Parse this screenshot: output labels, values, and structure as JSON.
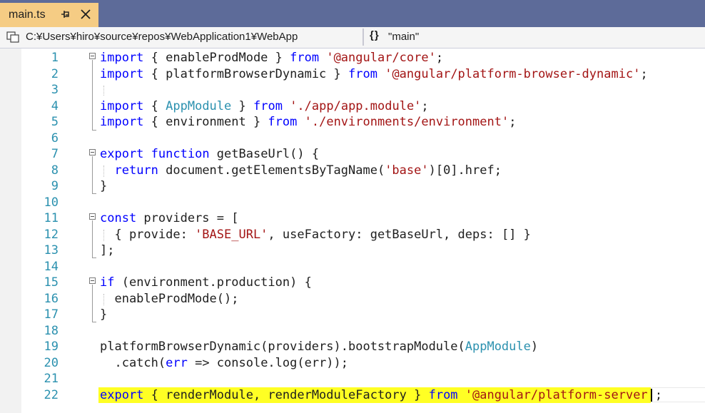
{
  "tab": {
    "title": "main.ts",
    "pin_icon": "pin-icon",
    "close_icon": "close-icon"
  },
  "navbar": {
    "project_icon": "project-icon",
    "project_path": "C:¥Users¥hiro¥source¥repos¥WebApplication1¥WebApp",
    "member_icon": "braces-icon",
    "member": "\"main\""
  },
  "colors": {
    "tabstrip": "#5d6b99",
    "active_tab": "#f5cc84",
    "keyword": "#0000ff",
    "string": "#a31515",
    "type": "#2b91af",
    "line_number": "#2b91af",
    "highlight": "#ffff24"
  },
  "code_lines": [
    {
      "n": "1",
      "tokens": [
        [
          "kw",
          "import"
        ],
        [
          "t",
          " { enableProdMode } "
        ],
        [
          "kw",
          "from"
        ],
        [
          "t",
          " "
        ],
        [
          "str",
          "'@angular/core'"
        ],
        [
          "t",
          ";"
        ]
      ]
    },
    {
      "n": "2",
      "tokens": [
        [
          "kw",
          "import"
        ],
        [
          "t",
          " { platformBrowserDynamic } "
        ],
        [
          "kw",
          "from"
        ],
        [
          "t",
          " "
        ],
        [
          "str",
          "'@angular/platform-browser-dynamic'"
        ],
        [
          "t",
          ";"
        ]
      ]
    },
    {
      "n": "3",
      "tokens": []
    },
    {
      "n": "4",
      "tokens": [
        [
          "kw",
          "import"
        ],
        [
          "t",
          " { "
        ],
        [
          "type",
          "AppModule"
        ],
        [
          "t",
          " } "
        ],
        [
          "kw",
          "from"
        ],
        [
          "t",
          " "
        ],
        [
          "str",
          "'./app/app.module'"
        ],
        [
          "t",
          ";"
        ]
      ]
    },
    {
      "n": "5",
      "tokens": [
        [
          "kw",
          "import"
        ],
        [
          "t",
          " { environment } "
        ],
        [
          "kw",
          "from"
        ],
        [
          "t",
          " "
        ],
        [
          "str",
          "'./environments/environment'"
        ],
        [
          "t",
          ";"
        ]
      ]
    },
    {
      "n": "6",
      "tokens": []
    },
    {
      "n": "7",
      "tokens": [
        [
          "kw",
          "export"
        ],
        [
          "t",
          " "
        ],
        [
          "kw",
          "function"
        ],
        [
          "t",
          " getBaseUrl() {"
        ]
      ]
    },
    {
      "n": "8",
      "tokens": [
        [
          "t",
          "  "
        ],
        [
          "kw",
          "return"
        ],
        [
          "t",
          " document.getElementsByTagName("
        ],
        [
          "str",
          "'base'"
        ],
        [
          "t",
          ")[0].href;"
        ]
      ]
    },
    {
      "n": "9",
      "tokens": [
        [
          "t",
          "}"
        ]
      ]
    },
    {
      "n": "10",
      "tokens": []
    },
    {
      "n": "11",
      "tokens": [
        [
          "kw",
          "const"
        ],
        [
          "t",
          " providers = ["
        ]
      ]
    },
    {
      "n": "12",
      "tokens": [
        [
          "t",
          "  { provide: "
        ],
        [
          "str",
          "'BASE_URL'"
        ],
        [
          "t",
          ", useFactory: getBaseUrl, deps: [] }"
        ]
      ]
    },
    {
      "n": "13",
      "tokens": [
        [
          "t",
          "];"
        ]
      ]
    },
    {
      "n": "14",
      "tokens": []
    },
    {
      "n": "15",
      "tokens": [
        [
          "kw",
          "if"
        ],
        [
          "t",
          " (environment.production) {"
        ]
      ]
    },
    {
      "n": "16",
      "tokens": [
        [
          "t",
          "  enableProdMode();"
        ]
      ]
    },
    {
      "n": "17",
      "tokens": [
        [
          "t",
          "}"
        ]
      ]
    },
    {
      "n": "18",
      "tokens": []
    },
    {
      "n": "19",
      "tokens": [
        [
          "t",
          "platformBrowserDynamic(providers).bootstrapModule("
        ],
        [
          "type",
          "AppModule"
        ],
        [
          "t",
          ")"
        ]
      ]
    },
    {
      "n": "20",
      "tokens": [
        [
          "t",
          "  .catch("
        ],
        [
          "kw",
          "err"
        ],
        [
          "t",
          " => console.log(err));"
        ]
      ]
    },
    {
      "n": "21",
      "tokens": []
    },
    {
      "n": "22",
      "tokens": [
        [
          "kw",
          "export"
        ],
        [
          "t",
          " { renderModule, renderModuleFactory } "
        ],
        [
          "kw",
          "from"
        ],
        [
          "t",
          " "
        ],
        [
          "str",
          "'@angular/platform-server'"
        ],
        [
          "t",
          ";"
        ]
      ],
      "highlighted": true,
      "current": true
    }
  ]
}
